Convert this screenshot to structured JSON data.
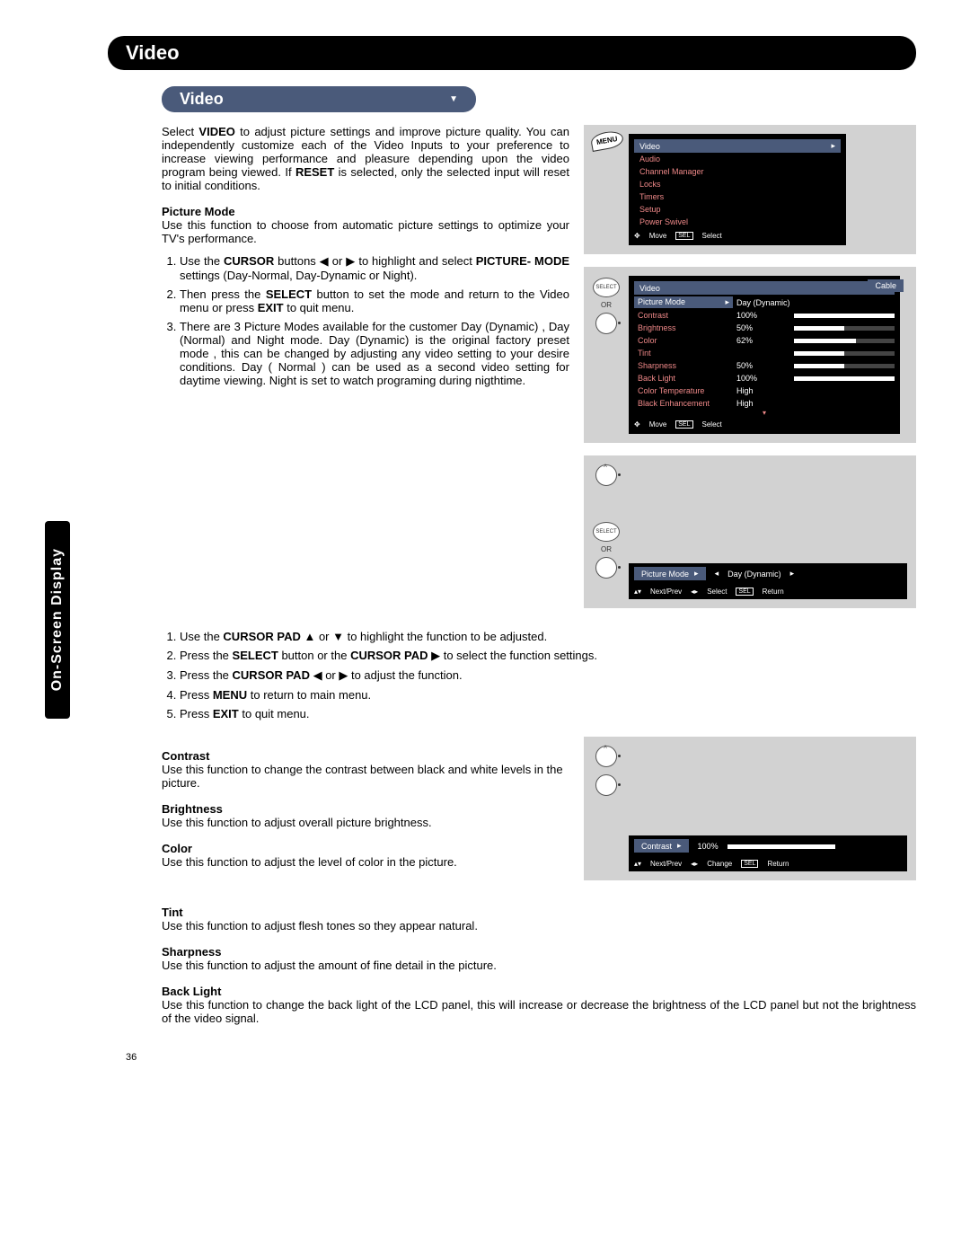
{
  "sideTab": "On-Screen Display",
  "sectionTitle": "Video",
  "subTitle": "Video",
  "intro": {
    "prefix": "Select ",
    "videoWord": "VIDEO",
    "mid": " to adjust picture settings and improve picture quality. You can independently customize each of the Video Inputs to your preference to increase viewing performance and pleasure depending upon the video program being viewed. If ",
    "resetWord": "RESET",
    "suffix": " is selected, only the selected input will reset to initial conditions."
  },
  "pictureMode": {
    "title": "Picture Mode",
    "desc": "Use this function to choose from automatic picture settings to optimize your TV's performance.",
    "steps": [
      {
        "pre": "Use the ",
        "b1": "CURSOR",
        "mid1": " buttons ◀ or ▶ to highlight and select ",
        "b2": "PICTURE- MODE",
        "mid2": " settings (Day-Normal, Day-Dynamic or Night)."
      },
      {
        "pre": "Then press the ",
        "b1": "SELECT",
        "mid1": " button to set the mode and return to the Video menu or press ",
        "b2": "EXIT",
        "mid2": " to quit menu."
      },
      {
        "pre": "There are 3 Picture Modes  available for the customer Day (Dynamic) , Day (Normal) and Night mode. Day (Dynamic) is the original factory preset mode , this can be changed by adjusting any video setting  to your desire conditions. Day ( Normal ) can be used as a second video setting for daytime viewing. Night is set to watch programing during nigthtime."
      }
    ]
  },
  "generalSteps": [
    {
      "pre": "Use the ",
      "b": "CURSOR PAD",
      "suf": " ▲ or ▼ to highlight the function to be adjusted."
    },
    {
      "pre": "Press the ",
      "b": "SELECT",
      "mid": " button or the ",
      "b2": "CURSOR PAD",
      "suf": " ▶ to select the function settings."
    },
    {
      "pre": "Press the ",
      "b": "CURSOR PAD",
      "suf": " ◀ or ▶ to adjust the function."
    },
    {
      "pre": "Press ",
      "b": "MENU",
      "suf": " to return to main menu."
    },
    {
      "pre": "Press ",
      "b": "EXIT",
      "suf": " to quit menu."
    }
  ],
  "defs": {
    "contrast": {
      "t": "Contrast",
      "d": "Use this function to change the contrast between black and white levels in the picture."
    },
    "brightness": {
      "t": "Brightness",
      "d": "Use this function to adjust overall picture brightness."
    },
    "color": {
      "t": "Color",
      "d": "Use this function to adjust the level of color in the picture."
    },
    "tint": {
      "t": "Tint",
      "d": "Use this function to adjust flesh tones so they appear natural."
    },
    "sharpness": {
      "t": "Sharpness",
      "d": "Use this function to adjust the amount of fine detail in the picture."
    },
    "backlight": {
      "t": "Back Light",
      "d": "Use this function to change the back light of the LCD panel, this will increase or decrease the brightness of the LCD panel but not the brightness of the video signal."
    }
  },
  "osd1": {
    "menuBadge": "MENU",
    "items": [
      "Video",
      "Audio",
      "Channel Manager",
      "Locks",
      "Timers",
      "Setup",
      "Power Swivel"
    ],
    "hintMove": "Move",
    "hintSel": "Select",
    "selBox": "SEL"
  },
  "osd2": {
    "selectBtn": "SELECT",
    "or": "OR",
    "header": "Video",
    "cable": "Cable",
    "rows": [
      {
        "l": "Picture Mode",
        "v": "Day (Dynamic)",
        "bar": null,
        "sel": true
      },
      {
        "l": "Contrast",
        "v": "100%",
        "bar": 100
      },
      {
        "l": "Brightness",
        "v": "50%",
        "bar": 50
      },
      {
        "l": "Color",
        "v": "62%",
        "bar": 62
      },
      {
        "l": "Tint",
        "v": "",
        "bar": 50
      },
      {
        "l": "Sharpness",
        "v": "50%",
        "bar": 50
      },
      {
        "l": "Back Light",
        "v": "100%",
        "bar": 100
      },
      {
        "l": "Color Temperature",
        "v": "High",
        "bar": null
      },
      {
        "l": "Black Enhancement",
        "v": "High",
        "bar": null
      }
    ],
    "hintMove": "Move",
    "hintSel": "Select",
    "selBox": "SEL"
  },
  "osd3": {
    "selectBtn": "SELECT",
    "or": "OR",
    "label": "Picture Mode",
    "value": "Day (Dynamic)",
    "hintNext": "Next/Prev",
    "hintSelect": "Select",
    "hintReturn": "Return",
    "selBox": "SEL"
  },
  "osd4": {
    "label": "Contrast",
    "value": "100%",
    "bar": 100,
    "hintNext": "Next/Prev",
    "hintChange": "Change",
    "hintReturn": "Return",
    "selBox": "SEL"
  },
  "pageNum": "36"
}
